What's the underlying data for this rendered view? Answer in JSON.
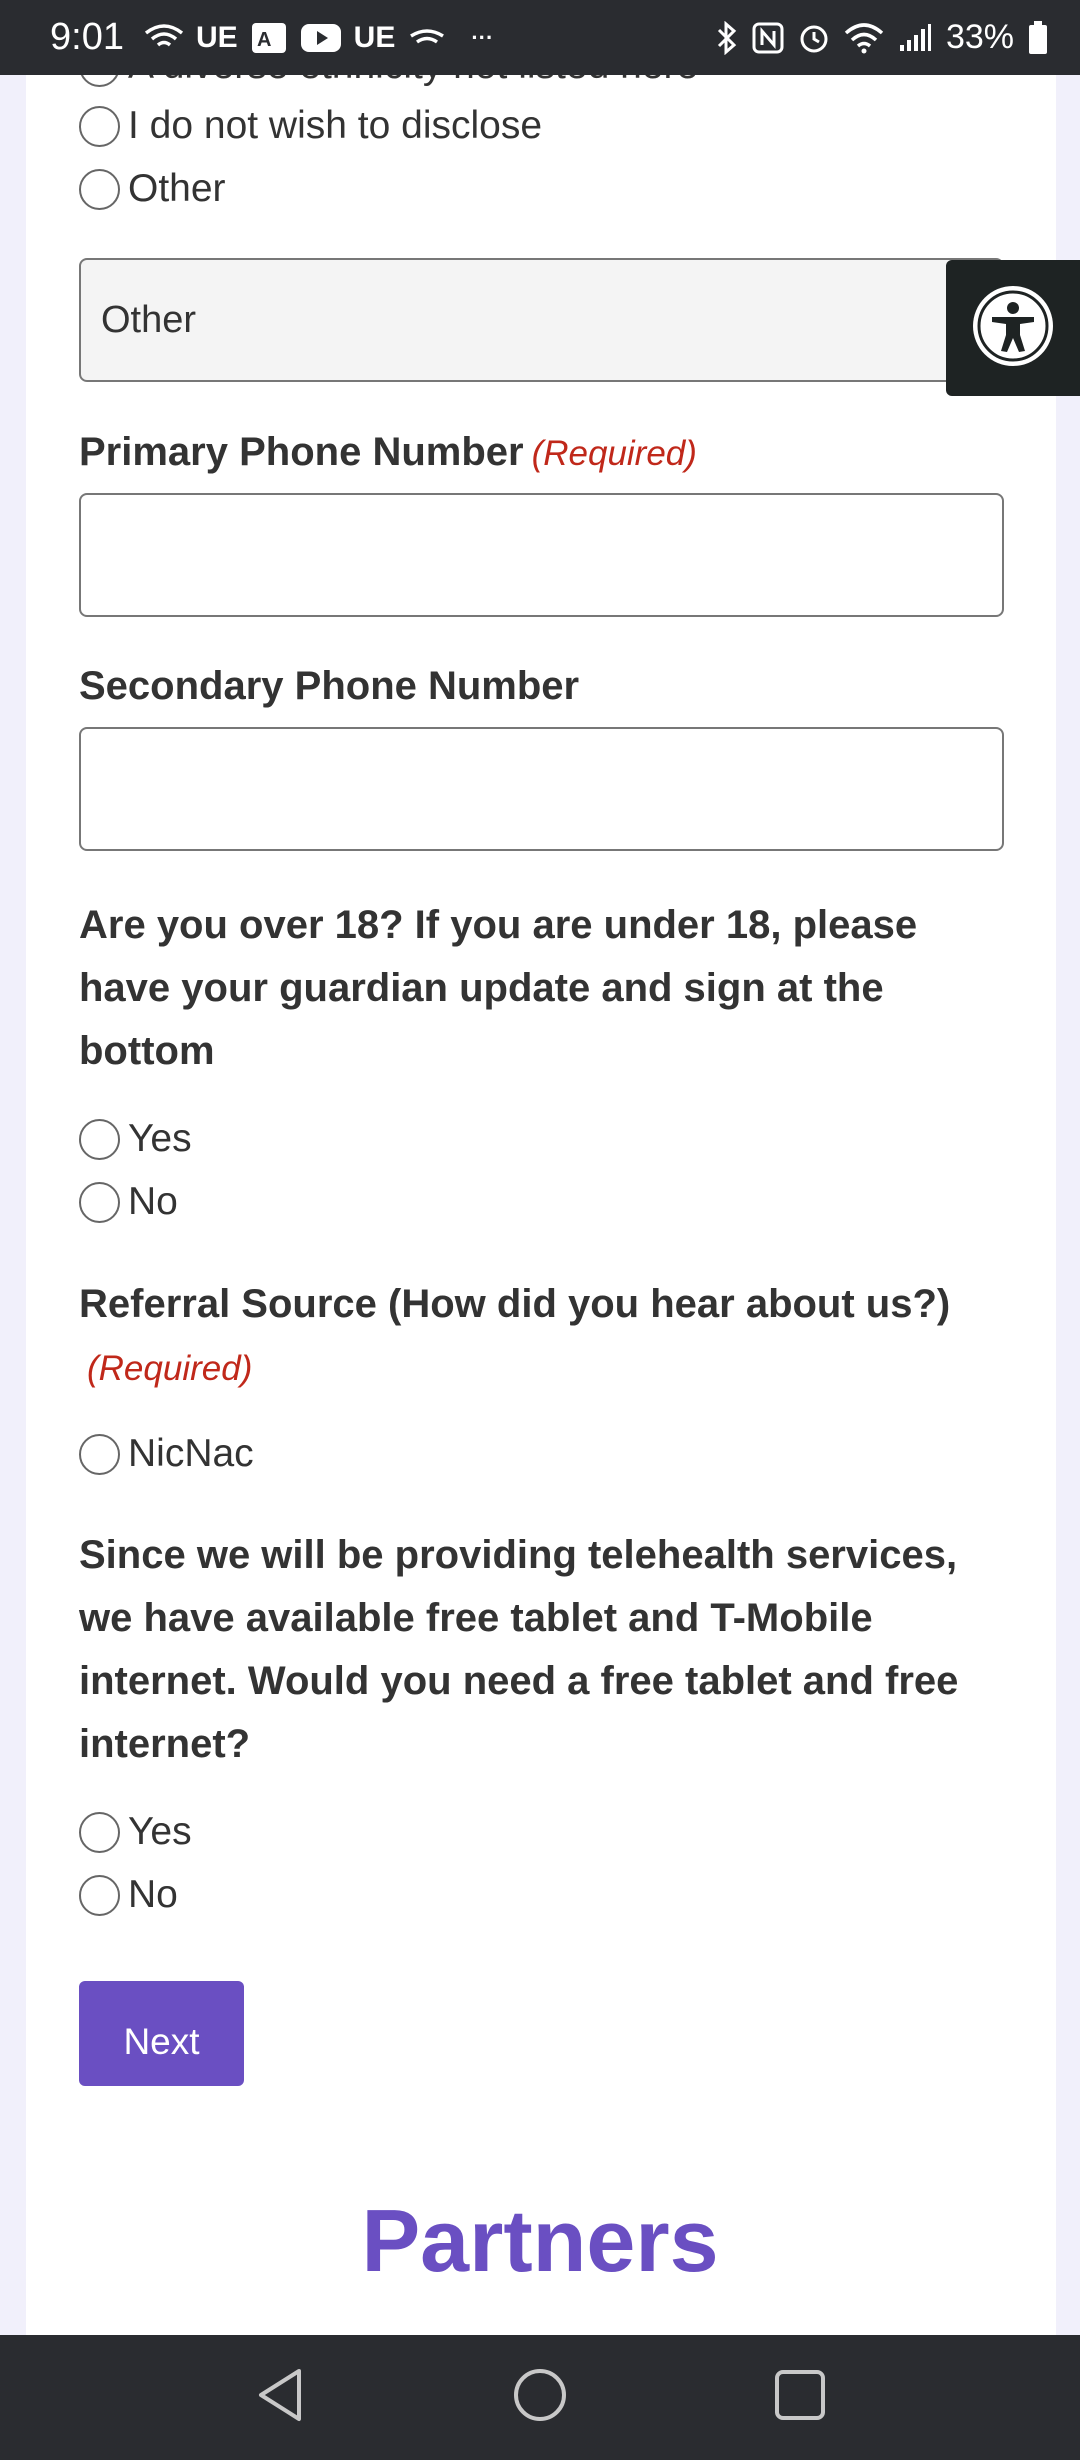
{
  "status_bar": {
    "time": "9:01",
    "carrier_1": "UE",
    "carrier_2": "UE",
    "more": "···",
    "battery": "33%",
    "icons": [
      "wifi-calling-icon",
      "translate-icon",
      "youtube-icon",
      "bluetooth-icon",
      "nfc-icon",
      "alarm-icon",
      "wifi-icon",
      "signal-icon",
      "battery-icon"
    ]
  },
  "ethnicity": {
    "partial_option": "A diverse ethnicity not listed here",
    "options": [
      "I do not wish to disclose",
      "Other"
    ],
    "other_value": "Other"
  },
  "primary_phone": {
    "label": "Primary Phone Number",
    "required": "(Required)",
    "value": ""
  },
  "secondary_phone": {
    "label": "Secondary Phone Number",
    "value": ""
  },
  "over18": {
    "question": "Are you over 18? If you are under 18, please have your guardian update and sign at the bottom",
    "options": [
      "Yes",
      "No"
    ]
  },
  "referral": {
    "question": "Referral Source (How did you hear about us?)",
    "required": "(Required)",
    "options": [
      "NicNac"
    ]
  },
  "tablet": {
    "question": "Since we will be providing telehealth services, we have available free tablet and T-Mobile internet. Would you need a free tablet and free internet?",
    "options": [
      "Yes",
      "No"
    ]
  },
  "actions": {
    "next_label": "Next"
  },
  "footer": {
    "partners_heading": "Partners"
  },
  "colors": {
    "accent": "#6a4fc2",
    "required": "#c0281a",
    "bars": "#2a2c30"
  }
}
